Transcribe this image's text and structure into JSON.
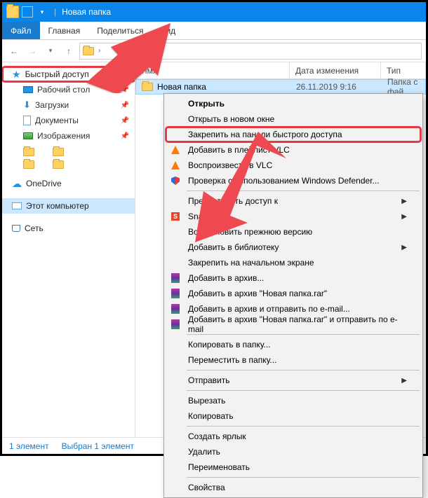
{
  "title": "Новая папка",
  "ribbon": {
    "file": "Файл",
    "home": "Главная",
    "share": "Поделиться",
    "view": "Вид"
  },
  "sidebar": {
    "quick_access": "Быстрый доступ",
    "desktop": "Рабочий стол",
    "downloads": "Загрузки",
    "documents": "Документы",
    "pictures": "Изображения",
    "onedrive": "OneDrive",
    "this_pc": "Этот компьютер",
    "network": "Сеть"
  },
  "columns": {
    "name": "Имя",
    "date": "Дата изменения",
    "type": "Тип"
  },
  "row": {
    "name": "Новая папка",
    "date": "26.11.2019 9:16",
    "type": "Папка с фай"
  },
  "status": {
    "count": "1 элемент",
    "selected": "Выбран 1 элемент"
  },
  "menu": {
    "open": "Открыть",
    "open_new": "Открыть в новом окне",
    "pin_quick": "Закрепить на панели быстрого доступа",
    "vlc_playlist": "Добавить в плейлист VLC",
    "vlc_play": "Воспроизвести в VLC",
    "defender": "Проверка с использованием Windows Defender...",
    "share_access": "Предоставить доступ к",
    "snagit": "Snagit",
    "restore": "Восстановить прежнюю версию",
    "library": "Добавить в библиотеку",
    "pin_start": "Закрепить на начальном экране",
    "rar_add": "Добавить в архив...",
    "rar_add_named": "Добавить в архив \"Новая папка.rar\"",
    "rar_mail": "Добавить в архив и отправить по e-mail...",
    "rar_named_mail": "Добавить в архив \"Новая папка.rar\" и отправить по e-mail",
    "copy_to": "Копировать в папку...",
    "move_to": "Переместить в папку...",
    "send_to": "Отправить",
    "cut": "Вырезать",
    "copy": "Копировать",
    "shortcut": "Создать ярлык",
    "delete": "Удалить",
    "rename": "Переименовать",
    "props": "Свойства"
  }
}
